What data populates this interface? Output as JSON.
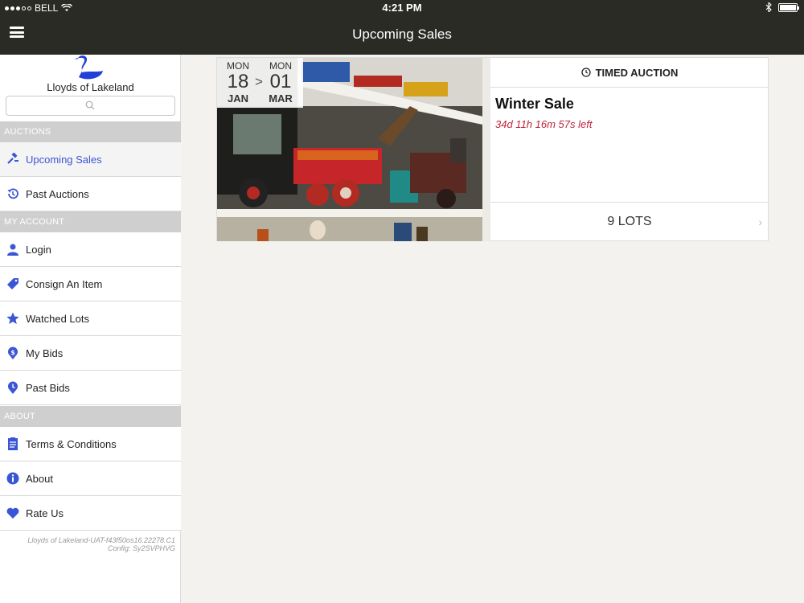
{
  "status_bar": {
    "carrier": "BELL",
    "time": "4:21 PM"
  },
  "nav": {
    "title": "Upcoming Sales"
  },
  "brand": {
    "name": "Lloyds of Lakeland"
  },
  "search": {
    "placeholder": ""
  },
  "sidebar": {
    "sections": [
      {
        "label": "AUCTIONS"
      },
      {
        "label": "MY ACCOUNT"
      },
      {
        "label": "ABOUT"
      }
    ],
    "items": [
      {
        "label": "Upcoming Sales",
        "icon": "gavel-icon"
      },
      {
        "label": "Past Auctions",
        "icon": "history-icon"
      },
      {
        "label": "Login",
        "icon": "user-icon"
      },
      {
        "label": "Consign An Item",
        "icon": "tag-icon"
      },
      {
        "label": "Watched Lots",
        "icon": "star-icon"
      },
      {
        "label": "My Bids",
        "icon": "dollar-icon"
      },
      {
        "label": "Past Bids",
        "icon": "clock-icon"
      },
      {
        "label": "Terms & Conditions",
        "icon": "document-icon"
      },
      {
        "label": "About",
        "icon": "info-icon"
      },
      {
        "label": "Rate Us",
        "icon": "heart-icon"
      }
    ],
    "version_line1": "Lloyds of Lakeland-UAT-f43f50os16.22278.C1",
    "version_line2": "Config: Sy2SVPHVG"
  },
  "sale": {
    "start": {
      "dow": "MON",
      "day": "18",
      "month": "JAN"
    },
    "end": {
      "dow": "MON",
      "day": "01",
      "month": "MAR"
    },
    "arrow": ">",
    "type": "TIMED AUCTION",
    "title": "Winter Sale",
    "time_left": "34d 11h 16m 57s left",
    "lots": "9 LOTS"
  },
  "colors": {
    "accent": "#3a55d6",
    "countdown": "#c0243c",
    "navbar": "#2b2b26",
    "section_header": "#cfcfcf"
  }
}
